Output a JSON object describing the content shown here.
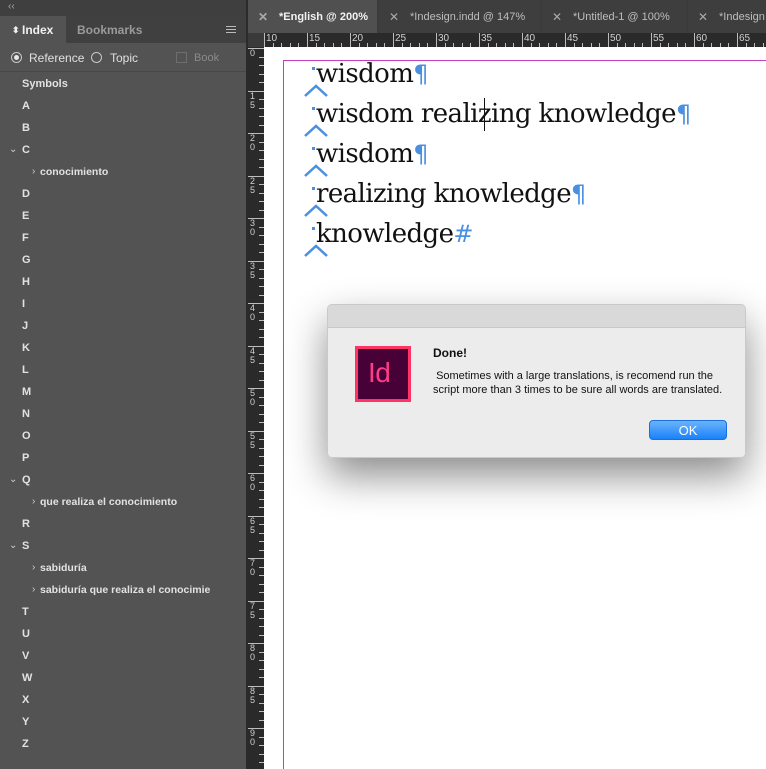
{
  "panel": {
    "tabs": [
      "Index",
      "Bookmarks"
    ],
    "options": {
      "reference": "Reference",
      "topic": "Topic",
      "book": "Book"
    },
    "entries": [
      {
        "label": "Symbols",
        "chevron": ""
      },
      {
        "label": "A",
        "chevron": ""
      },
      {
        "label": "B",
        "chevron": ""
      },
      {
        "label": "C",
        "chevron": "⌄"
      },
      {
        "label": "conocimiento",
        "chevron": "›",
        "sub": true
      },
      {
        "label": "D",
        "chevron": ""
      },
      {
        "label": "E",
        "chevron": ""
      },
      {
        "label": "F",
        "chevron": ""
      },
      {
        "label": "G",
        "chevron": ""
      },
      {
        "label": "H",
        "chevron": ""
      },
      {
        "label": "I",
        "chevron": ""
      },
      {
        "label": "J",
        "chevron": ""
      },
      {
        "label": "K",
        "chevron": ""
      },
      {
        "label": "L",
        "chevron": ""
      },
      {
        "label": "M",
        "chevron": ""
      },
      {
        "label": "N",
        "chevron": ""
      },
      {
        "label": "O",
        "chevron": ""
      },
      {
        "label": "P",
        "chevron": ""
      },
      {
        "label": "Q",
        "chevron": "⌄"
      },
      {
        "label": "que realiza el conocimiento",
        "chevron": "›",
        "sub": true
      },
      {
        "label": "R",
        "chevron": ""
      },
      {
        "label": "S",
        "chevron": "⌄"
      },
      {
        "label": "sabiduría",
        "chevron": "›",
        "sub": true
      },
      {
        "label": "sabiduría que realiza el conocimie",
        "chevron": "›",
        "sub": true
      },
      {
        "label": "T",
        "chevron": ""
      },
      {
        "label": "U",
        "chevron": ""
      },
      {
        "label": "V",
        "chevron": ""
      },
      {
        "label": "W",
        "chevron": ""
      },
      {
        "label": "X",
        "chevron": ""
      },
      {
        "label": "Y",
        "chevron": ""
      },
      {
        "label": "Z",
        "chevron": ""
      }
    ]
  },
  "doc_tabs": [
    "*English @ 200%",
    "*Indesign.indd @ 147%",
    "*Untitled-1 @ 100%",
    "*Indesign"
  ],
  "ruler": {
    "top": [
      "10",
      "15",
      "20",
      "25",
      "30",
      "35",
      "40",
      "45",
      "50",
      "55",
      "60",
      "65"
    ],
    "left": [
      "0",
      "1 5",
      "2 0",
      "2 5",
      "3 0",
      "3 5",
      "4 0",
      "4 5",
      "5 0",
      "5 5",
      "6 0",
      "6 5",
      "7 0",
      "7 5",
      "8 0",
      "8 5",
      "9 0"
    ]
  },
  "document": {
    "lines": [
      {
        "text": "wisdom",
        "mark": "¶"
      },
      {
        "text": "wisdom realizing knowledge",
        "mark": "¶"
      },
      {
        "text": "wisdom",
        "mark": "¶"
      },
      {
        "text": "realizing knowledge",
        "mark": "¶"
      },
      {
        "text": "knowledge",
        "mark": "#"
      }
    ]
  },
  "dialog": {
    "app_icon_text": "Id",
    "title": "Done!",
    "message": " Sometimes with a large translations, is recomend run the script more than 3 times to be sure all words are translated.",
    "ok_label": "OK"
  },
  "colors": {
    "accent": "#4a90e2",
    "margin_guide": "#c040c0",
    "ok_button": "#1a82fb",
    "indesign_pink": "#ff3366"
  }
}
